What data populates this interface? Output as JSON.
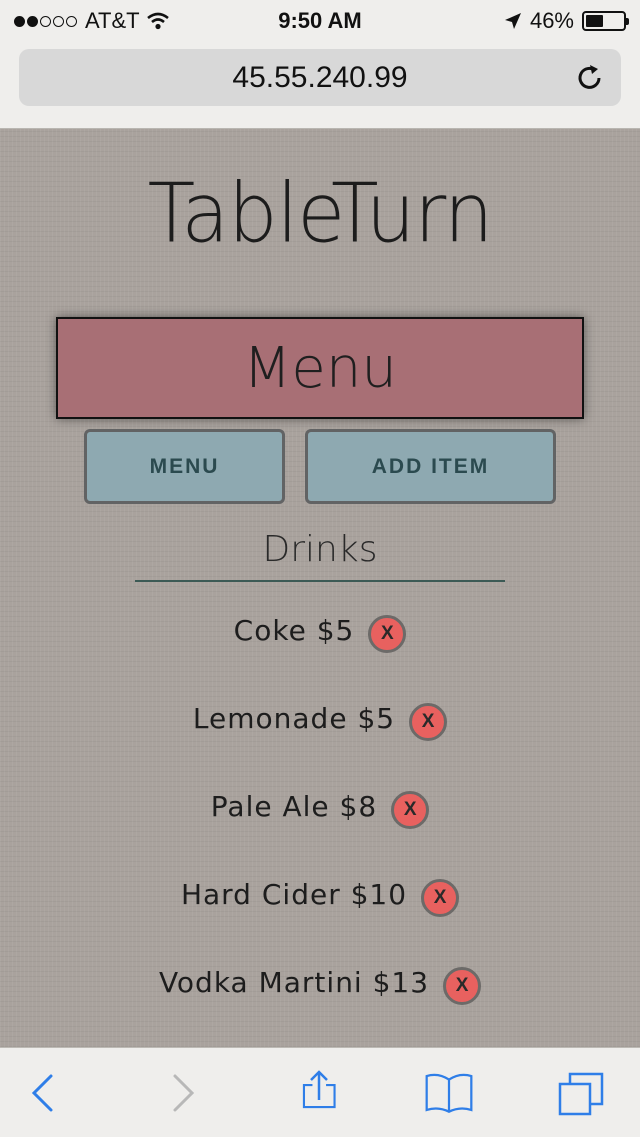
{
  "status_bar": {
    "carrier": "AT&T",
    "time": "9:50 AM",
    "battery": "46%",
    "battery_level": 0.46
  },
  "browser": {
    "url": "45.55.240.99"
  },
  "app": {
    "brand": "TableTurn",
    "page_title": "Menu",
    "nav": {
      "menu_label": "MENU",
      "add_item_label": "ADD ITEM"
    },
    "section": {
      "title": "Drinks",
      "items": [
        {
          "label": "Coke $5",
          "remove": "X"
        },
        {
          "label": "Lemonade $5",
          "remove": "X"
        },
        {
          "label": "Pale Ale $8",
          "remove": "X"
        },
        {
          "label": "Hard Cider $10",
          "remove": "X"
        },
        {
          "label": "Vodka Martini $13",
          "remove": "X"
        }
      ]
    }
  },
  "colors": {
    "title_box": "#a86f75",
    "nav_button": "#8ea9b1",
    "remove_button": "#e8615f",
    "ios_blue": "#2f7ee8"
  }
}
